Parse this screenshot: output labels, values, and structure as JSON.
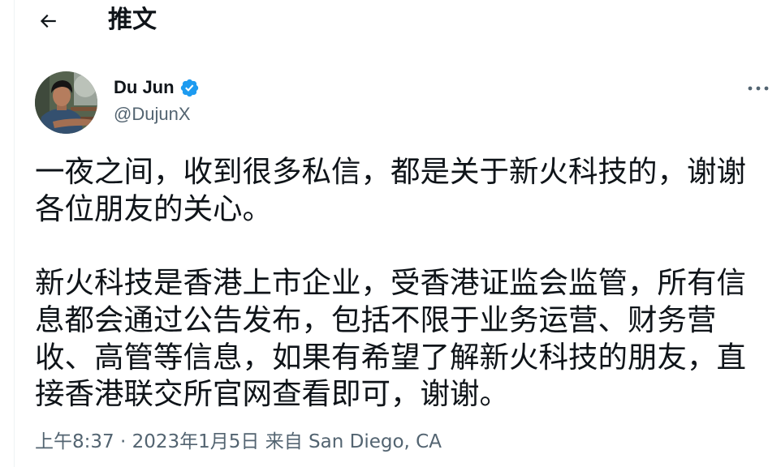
{
  "header": {
    "back_icon": "back-arrow-icon",
    "title": "推文"
  },
  "tweet": {
    "author": {
      "name": "Du Jun",
      "handle": "@DujunX",
      "verified": true,
      "verified_icon": "verified-badge-icon"
    },
    "more_icon": "more-horizontal-icon",
    "paragraphs": [
      [
        "一夜之间，收到很多私信，都是关于新火科技的，谢谢",
        "各位朋友的关心。"
      ],
      [
        "新火科技是香港上市企业，受香港证监会监管，所有信",
        "息都会通过公告发布，包括不限于业务运营、财务营",
        "收、高管等信息，如果有希望了解新火科技的朋友，直",
        "接香港联交所官网查看即可，谢谢。"
      ]
    ],
    "meta": {
      "time": "上午8:37",
      "separator": "·",
      "date": "2023年1月5日",
      "source_prefix": "来自",
      "location": "San Diego, CA"
    }
  },
  "colors": {
    "text": "#0f1419",
    "secondary": "#536471",
    "accent": "#1d9bf0",
    "border": "#eff3f4"
  }
}
